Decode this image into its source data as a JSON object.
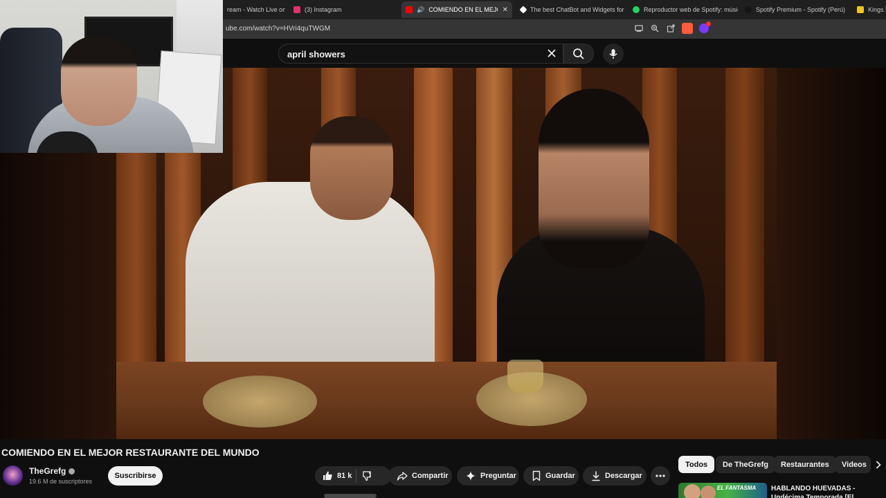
{
  "browser": {
    "tabs": [
      {
        "label": "ream - Watch Live on",
        "favicon_color": "#2b2b2b",
        "active": false
      },
      {
        "label": "(3) Instagram",
        "favicon_color": "#e1306c",
        "active": false
      },
      {
        "label": "COMIENDO EN EL MEJOR R",
        "favicon_color": "#ff0000",
        "active": true
      },
      {
        "label": "The best ChatBot and Widgets for",
        "favicon_color": "#ffffff",
        "active": false
      },
      {
        "label": "Reproductor web de Spotify: músic",
        "favicon_color": "#1ed760",
        "active": false
      },
      {
        "label": "Spotify Premium - Spotify (Perú)",
        "favicon_color": "#191414",
        "active": false
      },
      {
        "label": "Kings V",
        "favicon_color": "#f5c518",
        "active": false
      }
    ],
    "url": "ube.com/watch?v=HVri4quTWGM"
  },
  "search": {
    "query": "april showers"
  },
  "video": {
    "title": "COMIENDO EN EL MEJOR RESTAURANTE DEL MUNDO",
    "channel_name": "TheGrefg",
    "subscribers": "19.6 M de suscriptores",
    "subscribe_label": "Suscribirse",
    "likes": "81 k",
    "share_label": "Compartir",
    "ask_label": "Preguntar",
    "save_label": "Guardar",
    "download_label": "Descargar"
  },
  "chips": [
    "Todos",
    "De TheGrefg",
    "Restaurantes",
    "Videos"
  ],
  "recommendation": {
    "title": "HABLANDO HUEVADAS - Undécima Temporada [El",
    "thumb_text": "EL FANTASMA"
  },
  "colors": {
    "accent_red": "#ff0000",
    "background": "#0f0f0f",
    "chip_bg": "#272727"
  }
}
